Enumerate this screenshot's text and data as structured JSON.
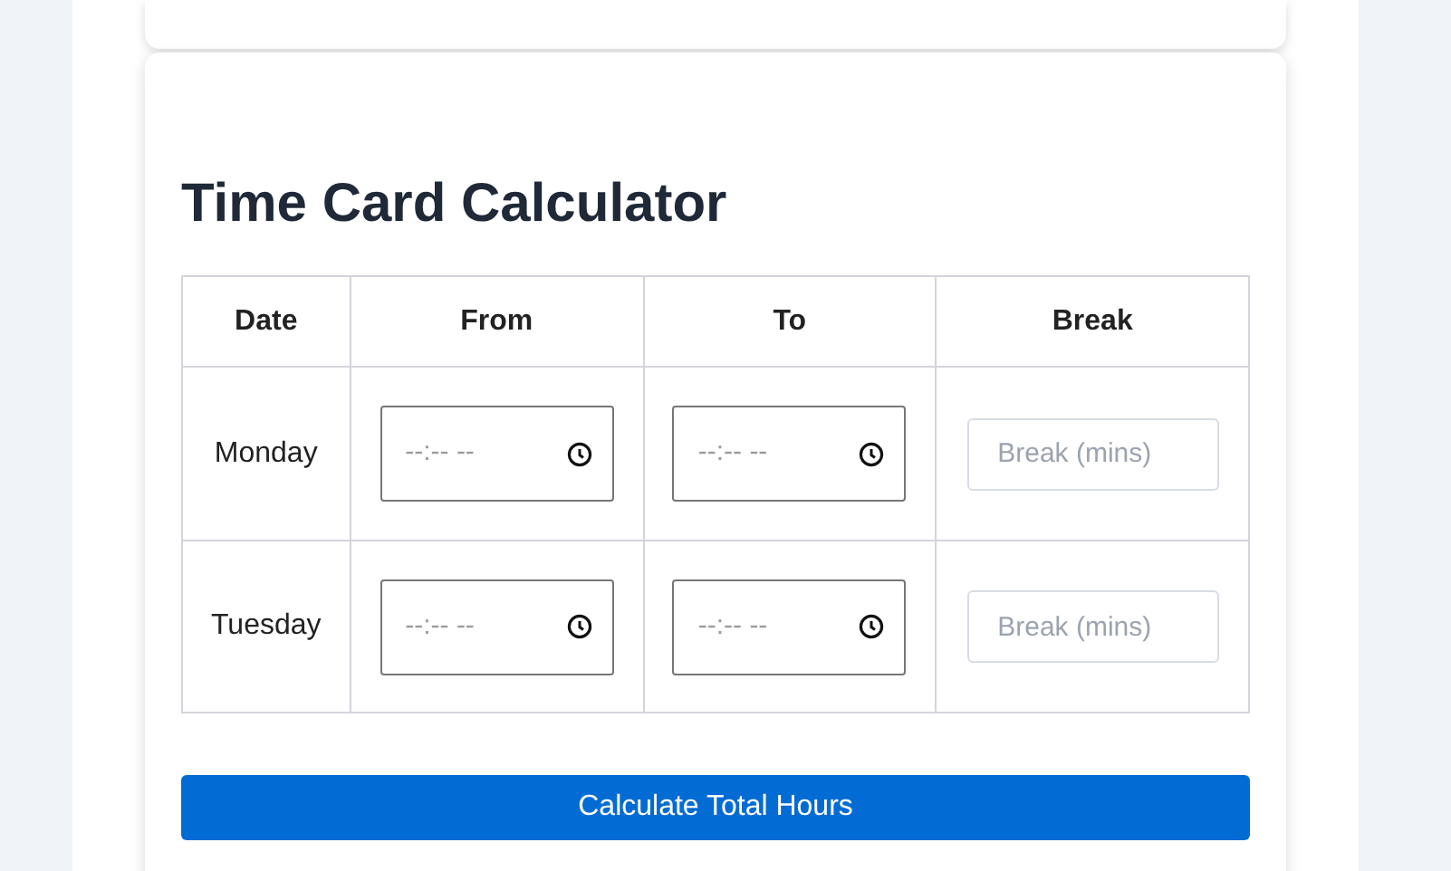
{
  "title": "Time Card Calculator",
  "table": {
    "columns": [
      "Date",
      "From",
      "To",
      "Break"
    ],
    "rows": [
      {
        "date": "Monday",
        "from": {
          "placeholder": "--:-- --"
        },
        "to": {
          "placeholder": "--:-- --"
        },
        "break": {
          "placeholder": "Break (mins)"
        }
      },
      {
        "date": "Tuesday",
        "from": {
          "placeholder": "--:-- --"
        },
        "to": {
          "placeholder": "--:-- --"
        },
        "break": {
          "placeholder": "Break (mins)"
        }
      }
    ]
  },
  "button": "Calculate Total Hours"
}
